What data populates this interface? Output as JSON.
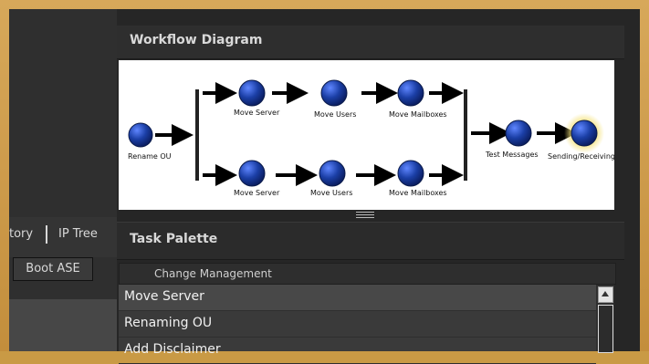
{
  "left": {
    "tab_1": "tory",
    "tab_2": "IP Tree",
    "boot_button": "Boot ASE"
  },
  "workflow": {
    "title": "Workflow Diagram",
    "nodes": {
      "rename_ou": "Rename OU",
      "top_move_server": "Move Server",
      "top_move_users": "Move Users",
      "top_move_mailboxes": "Move Mailboxes",
      "bottom_move_server": "Move Server",
      "bottom_move_users": "Move Users",
      "bottom_move_mailboxes": "Move Mailboxes",
      "test_messages": "Test Messages",
      "sending_receiving": "Sending/Receiving"
    }
  },
  "palette": {
    "title": "Task Palette",
    "category": "Change Management",
    "items": [
      "Move Server",
      "Renaming OU",
      "Add Disclaimer"
    ]
  },
  "colors": {
    "frame": "#c99a45",
    "node": "#1b3fa6",
    "node_glow": "#f4e27a"
  }
}
